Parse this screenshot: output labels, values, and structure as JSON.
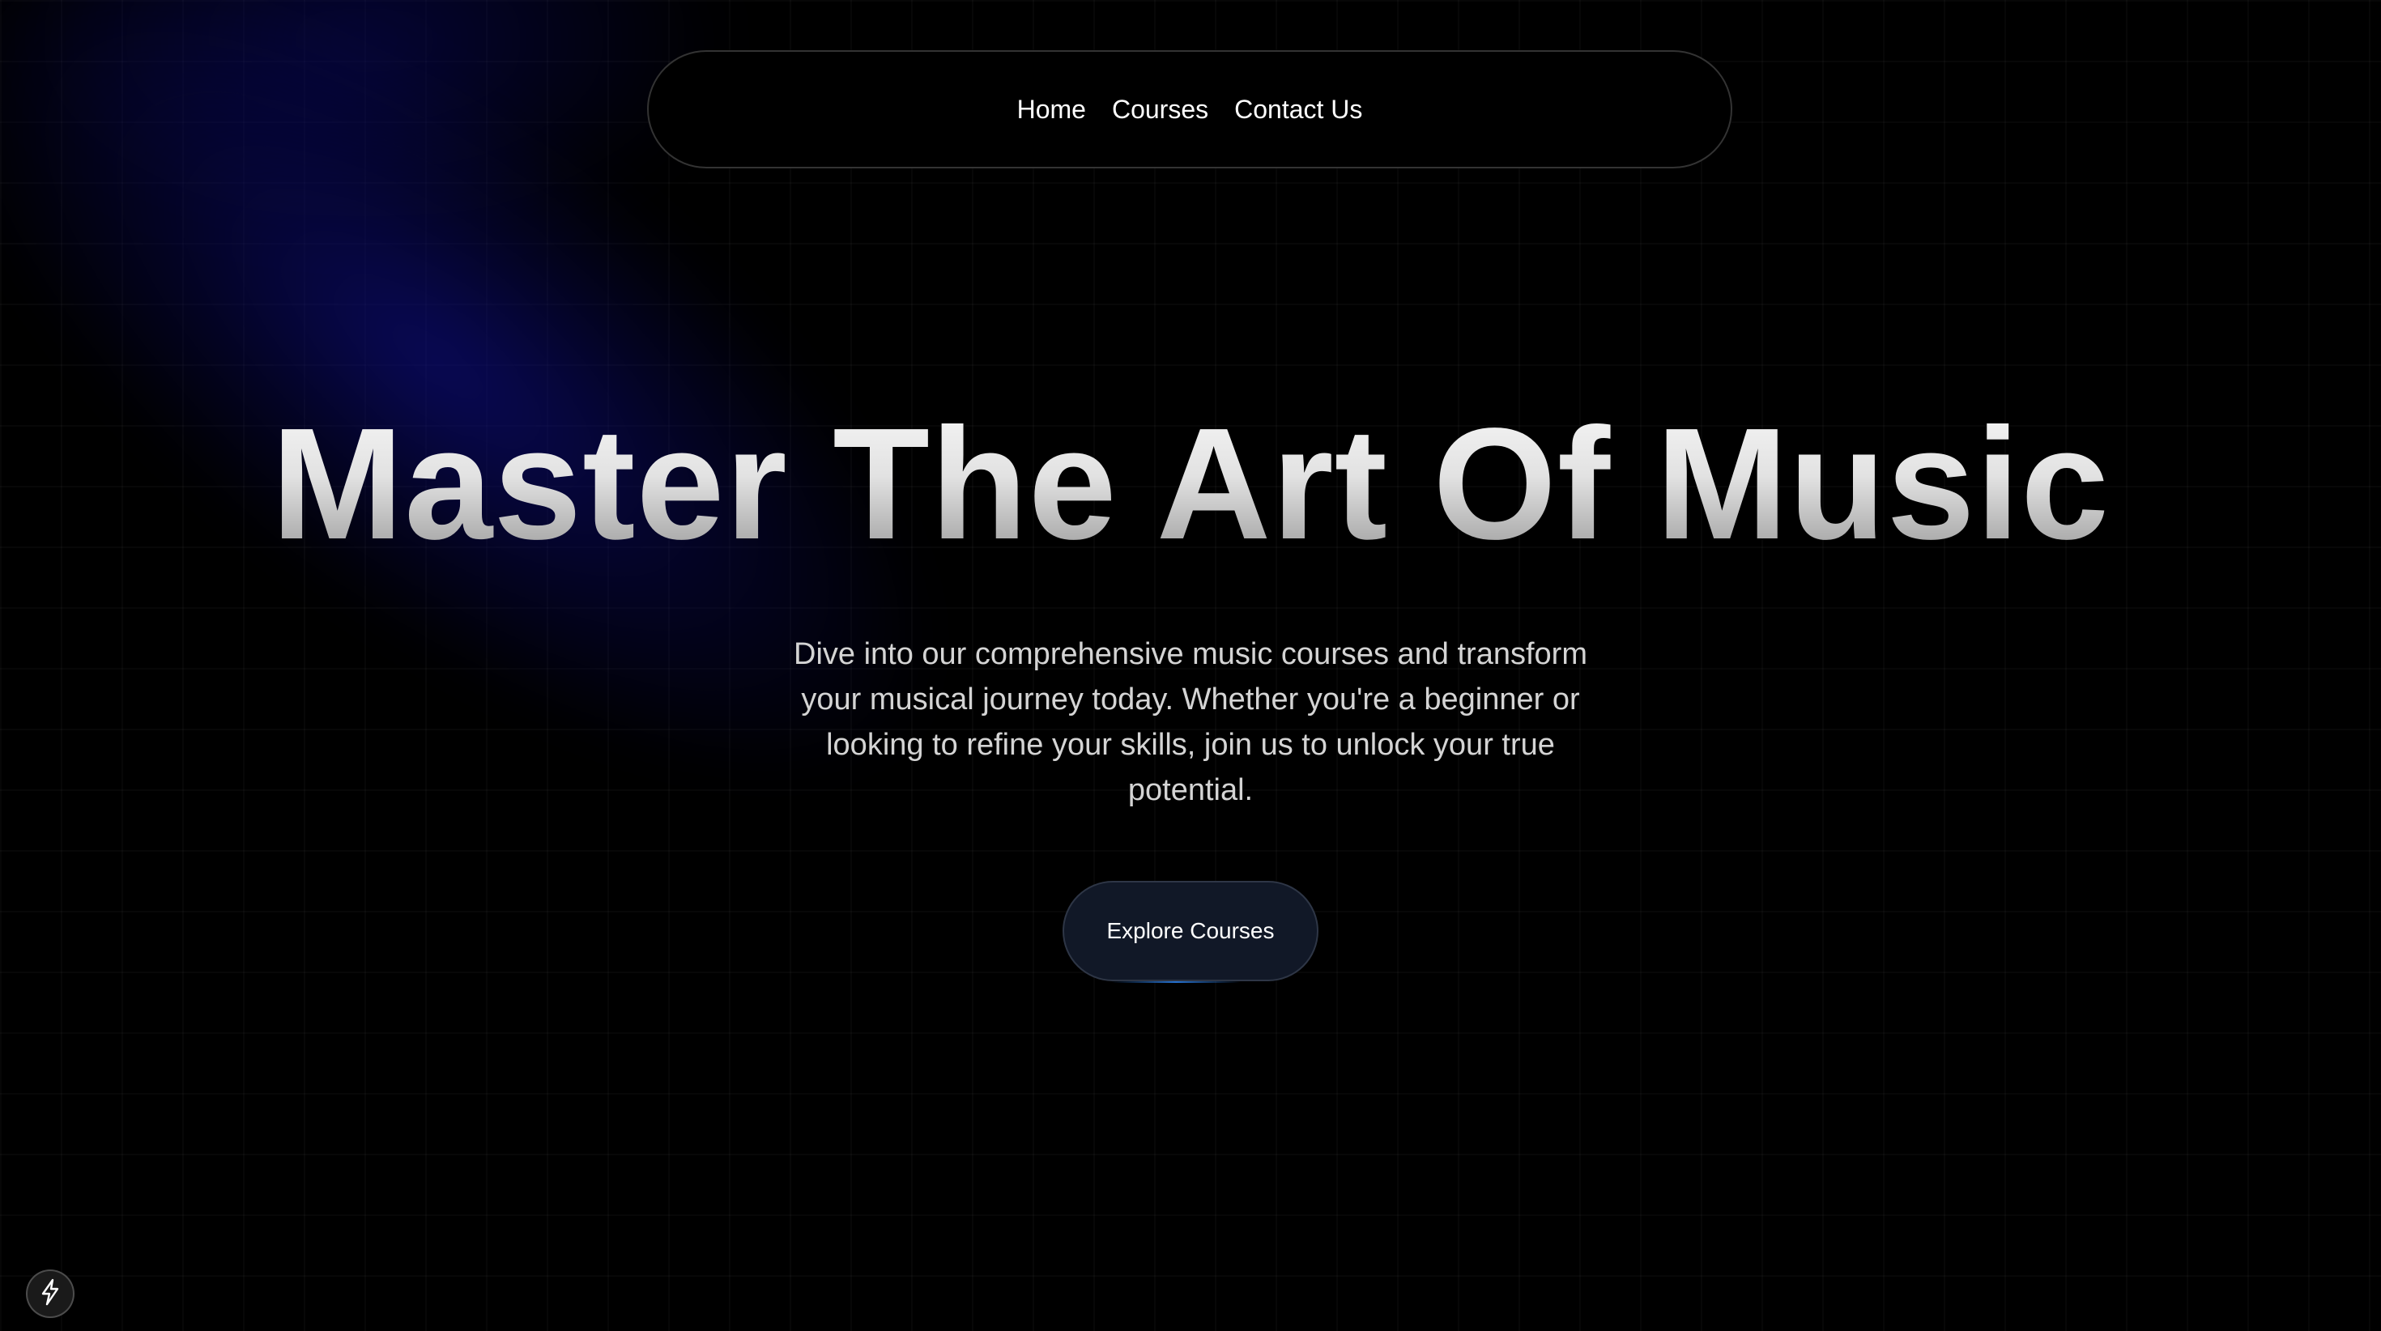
{
  "nav": {
    "items": [
      {
        "label": "Home"
      },
      {
        "label": "Courses"
      },
      {
        "label": "Contact Us"
      }
    ]
  },
  "hero": {
    "title": "Master The Art Of Music",
    "description": "Dive into our comprehensive music courses and transform your musical journey today. Whether you're a beginner or looking to refine your skills, join us to unlock your true potential.",
    "cta_label": "Explore Courses"
  },
  "badge": {
    "icon": "lightning-bolt-icon"
  },
  "colors": {
    "background": "#000000",
    "spotlight": "#0a0a78",
    "button_bg": "#111827",
    "button_glow": "#2878dc"
  }
}
